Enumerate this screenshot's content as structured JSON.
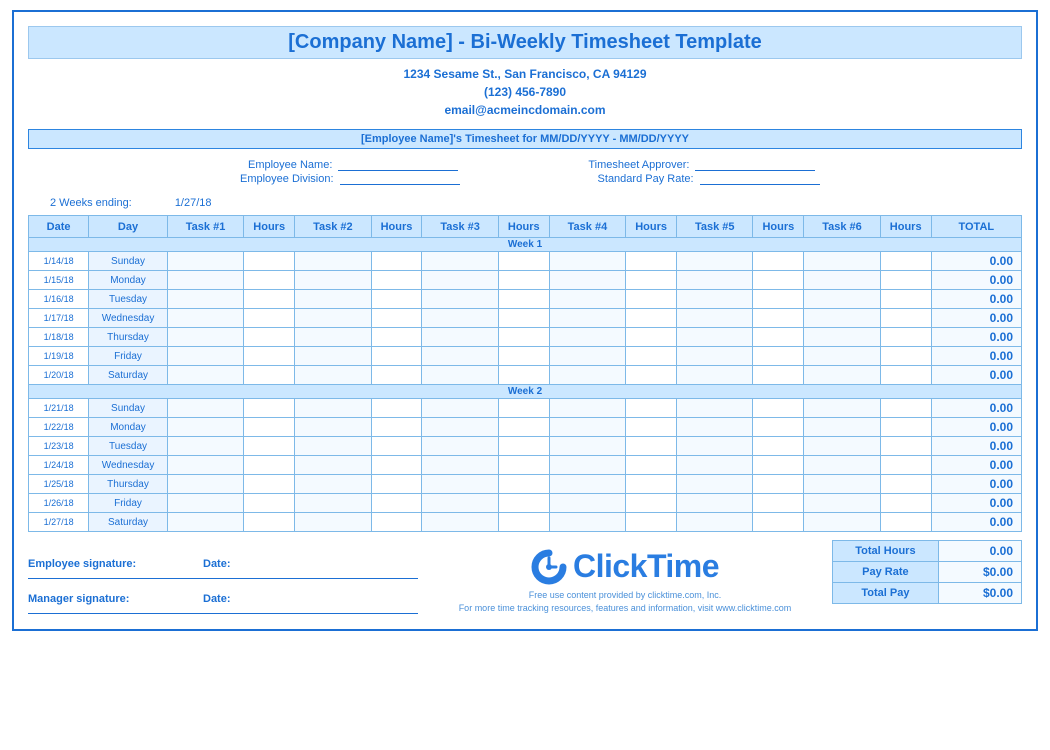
{
  "title": "[Company Name] - Bi-Weekly Timesheet Template",
  "company": {
    "address": "1234 Sesame St.,  San Francisco, CA 94129",
    "phone": "(123) 456-7890",
    "email": "email@acmeincdomain.com"
  },
  "band": "[Employee Name]'s Timesheet for MM/DD/YYYY - MM/DD/YYYY",
  "emp_labels": {
    "name": "Employee Name:",
    "division": "Employee Division:",
    "approver": "Timesheet Approver:",
    "rate": "Standard Pay Rate:"
  },
  "weeks_ending_label": "2 Weeks ending:",
  "weeks_ending_value": "1/27/18",
  "headers": {
    "date": "Date",
    "day": "Day",
    "task1": "Task #1",
    "task2": "Task #2",
    "task3": "Task #3",
    "task4": "Task #4",
    "task5": "Task #5",
    "task6": "Task #6",
    "hours": "Hours",
    "total": "TOTAL"
  },
  "week_labels": {
    "w1": "Week 1",
    "w2": "Week 2"
  },
  "week1": [
    {
      "date": "1/14/18",
      "day": "Sunday",
      "total": "0.00"
    },
    {
      "date": "1/15/18",
      "day": "Monday",
      "total": "0.00"
    },
    {
      "date": "1/16/18",
      "day": "Tuesday",
      "total": "0.00"
    },
    {
      "date": "1/17/18",
      "day": "Wednesday",
      "total": "0.00"
    },
    {
      "date": "1/18/18",
      "day": "Thursday",
      "total": "0.00"
    },
    {
      "date": "1/19/18",
      "day": "Friday",
      "total": "0.00"
    },
    {
      "date": "1/20/18",
      "day": "Saturday",
      "total": "0.00"
    }
  ],
  "week2": [
    {
      "date": "1/21/18",
      "day": "Sunday",
      "total": "0.00"
    },
    {
      "date": "1/22/18",
      "day": "Monday",
      "total": "0.00"
    },
    {
      "date": "1/23/18",
      "day": "Tuesday",
      "total": "0.00"
    },
    {
      "date": "1/24/18",
      "day": "Wednesday",
      "total": "0.00"
    },
    {
      "date": "1/25/18",
      "day": "Thursday",
      "total": "0.00"
    },
    {
      "date": "1/26/18",
      "day": "Friday",
      "total": "0.00"
    },
    {
      "date": "1/27/18",
      "day": "Saturday",
      "total": "0.00"
    }
  ],
  "sig": {
    "employee": "Employee signature:",
    "manager": "Manager signature:",
    "date": "Date:"
  },
  "summary": {
    "total_hours_label": "Total Hours",
    "total_hours_value": "0.00",
    "pay_rate_label": "Pay Rate",
    "pay_rate_value": "$0.00",
    "total_pay_label": "Total Pay",
    "total_pay_value": "$0.00"
  },
  "logo": "ClickTime",
  "footer1": "Free use content provided by clicktime.com, Inc.",
  "footer2": "For more time tracking resources, features and information, visit www.clicktime.com"
}
